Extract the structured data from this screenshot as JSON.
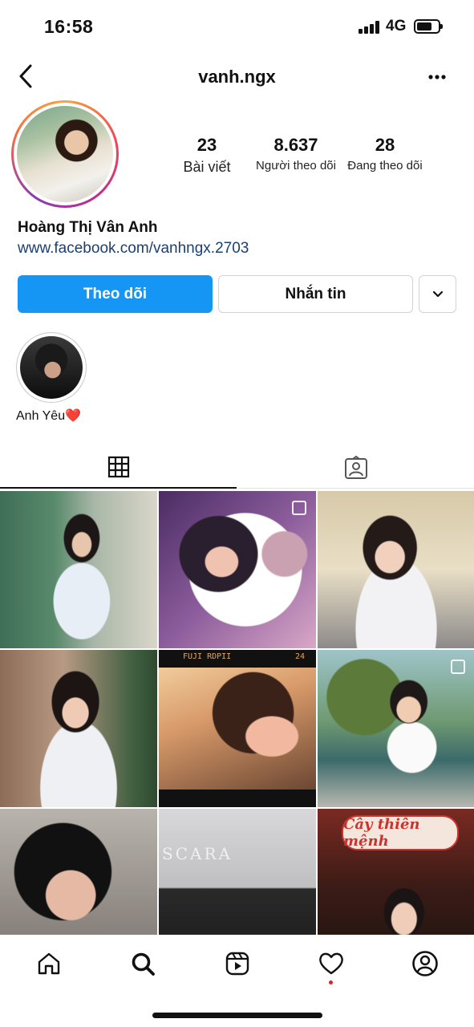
{
  "status_bar": {
    "time": "16:58",
    "network": "4G",
    "battery_level": 0.7
  },
  "header": {
    "username": "vanh.ngx",
    "back_icon": "chevron-left-icon",
    "more_icon": "ellipsis-icon"
  },
  "profile": {
    "full_name": "Hoàng Thị Vân Anh",
    "link": "www.facebook.com/vanhngx.2703",
    "stats": [
      {
        "value": "23",
        "label": "Bài viết"
      },
      {
        "value": "8.637",
        "label": "Người theo dõi"
      },
      {
        "value": "28",
        "label": "Đang theo dõi"
      }
    ]
  },
  "actions": {
    "follow_label": "Theo dõi",
    "message_label": "Nhắn tin",
    "dropdown_icon": "chevron-down-icon",
    "follow_color": "#1596f5"
  },
  "highlights": [
    {
      "label": "Anh Yêu",
      "emoji": "❤️"
    }
  ],
  "tabs": [
    {
      "icon": "grid-icon",
      "active": true
    },
    {
      "icon": "tagged-icon",
      "active": false
    }
  ],
  "posts": {
    "film_label_left": "FUJI RDPII",
    "film_label_right": "24",
    "sign_text": "Cây thiên mệnh",
    "storefront_text": "SCARA"
  },
  "bottom_nav": [
    {
      "icon": "home-icon"
    },
    {
      "icon": "search-icon",
      "active": true
    },
    {
      "icon": "reels-icon"
    },
    {
      "icon": "heart-icon",
      "has_notification": true
    },
    {
      "icon": "profile-icon"
    }
  ]
}
